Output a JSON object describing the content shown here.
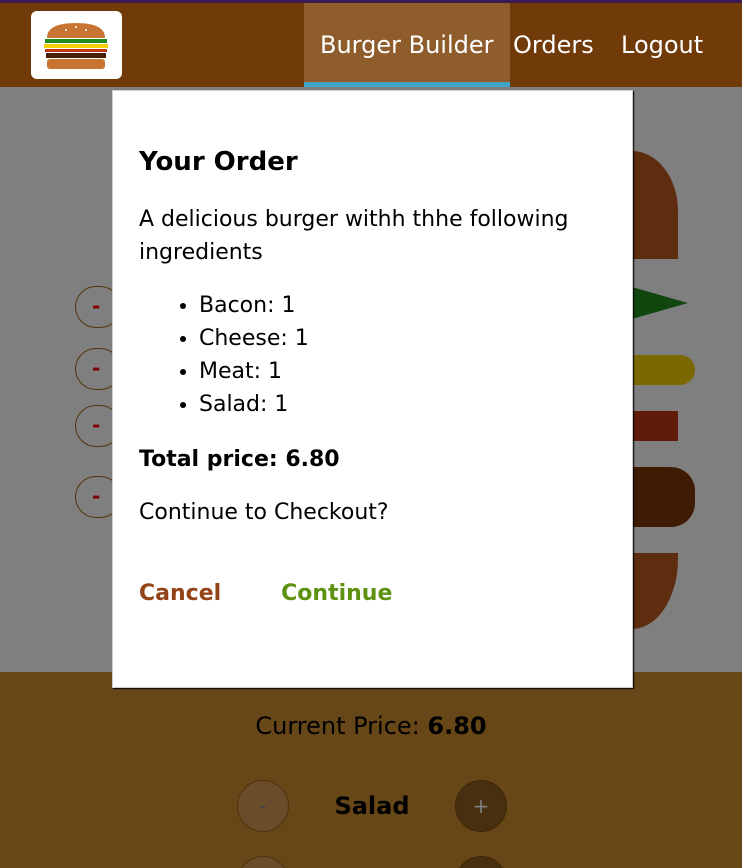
{
  "toolbar": {
    "logo_icon": "burger-logo-icon",
    "nav": [
      {
        "label": "Burger Builder",
        "active": true
      },
      {
        "label": "Orders",
        "active": false
      },
      {
        "label": "Logout",
        "active": false
      }
    ]
  },
  "burger": {
    "less_label": "-"
  },
  "build_controls": {
    "price_label": "Current Price:",
    "price_value": "6.80",
    "control_label": "Salad",
    "less_label": "-",
    "more_label": "+"
  },
  "modal": {
    "title": "Your Order",
    "intro": "A delicious burger withh thhe following ingredients",
    "ingredients": [
      {
        "name": "Bacon",
        "qty": 1,
        "text": "Bacon: 1"
      },
      {
        "name": "Cheese",
        "qty": 1,
        "text": "Cheese: 1"
      },
      {
        "name": "Meat",
        "qty": 1,
        "text": "Meat: 1"
      },
      {
        "name": "Salad",
        "qty": 1,
        "text": "Salad: 1"
      }
    ],
    "total_text": "Total price: 6.80",
    "question": "Continue to Checkout?",
    "cancel_label": "Cancel",
    "continue_label": "Continue"
  },
  "colors": {
    "toolbar": "#703b09",
    "active_nav_underline": "#40a4c8",
    "controls_bg": "#cf8f2e",
    "cancel": "#944317",
    "continue": "#5c9210"
  }
}
